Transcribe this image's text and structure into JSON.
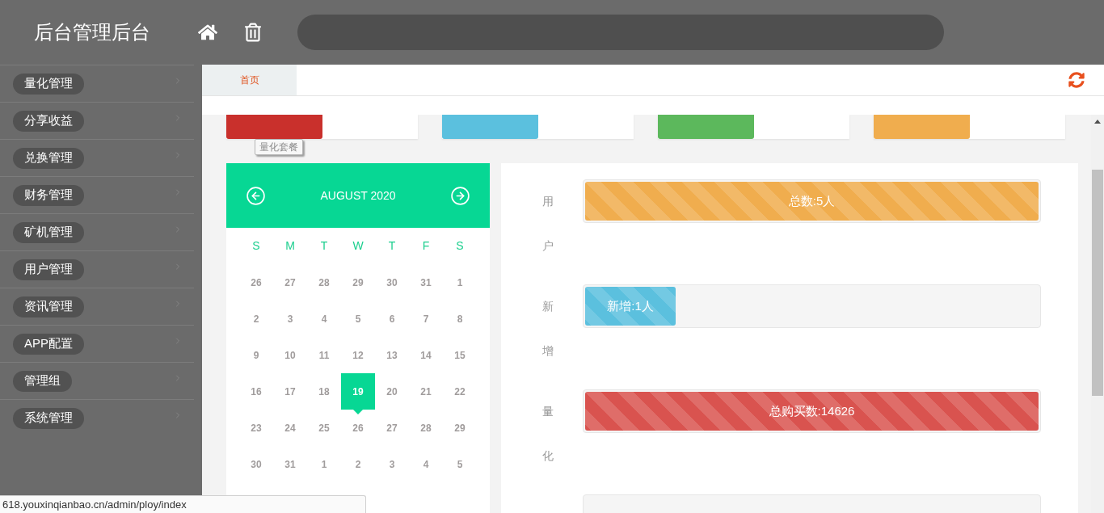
{
  "header": {
    "title": "后台管理后台"
  },
  "sidebar": {
    "items": [
      {
        "label": "量化管理"
      },
      {
        "label": "分享收益"
      },
      {
        "label": "兑换管理"
      },
      {
        "label": "财务管理"
      },
      {
        "label": "矿机管理"
      },
      {
        "label": "用户管理"
      },
      {
        "label": "资讯管理"
      },
      {
        "label": "APP配置"
      },
      {
        "label": "管理组"
      },
      {
        "label": "系统管理"
      }
    ]
  },
  "tabs": [
    {
      "label": "首页",
      "selected": true
    }
  ],
  "stat_cards": [
    {
      "color": "#c9302c"
    },
    {
      "color": "#5bc0de"
    },
    {
      "color": "#5cb85c"
    },
    {
      "color": "#f0ad4e"
    }
  ],
  "tooltip": {
    "text": "量化套餐"
  },
  "calendar": {
    "title": "AUGUST 2020",
    "weekdays": [
      "S",
      "M",
      "T",
      "W",
      "T",
      "F",
      "S"
    ],
    "weeks": [
      [
        {
          "day": "26",
          "selected": false
        },
        {
          "day": "27",
          "selected": false
        },
        {
          "day": "28",
          "selected": false
        },
        {
          "day": "29",
          "selected": false
        },
        {
          "day": "30",
          "selected": false
        },
        {
          "day": "31",
          "selected": false
        },
        {
          "day": "1",
          "selected": false
        }
      ],
      [
        {
          "day": "2",
          "selected": false
        },
        {
          "day": "3",
          "selected": false
        },
        {
          "day": "4",
          "selected": false
        },
        {
          "day": "5",
          "selected": false
        },
        {
          "day": "6",
          "selected": false
        },
        {
          "day": "7",
          "selected": false
        },
        {
          "day": "8",
          "selected": false
        }
      ],
      [
        {
          "day": "9",
          "selected": false
        },
        {
          "day": "10",
          "selected": false
        },
        {
          "day": "11",
          "selected": false
        },
        {
          "day": "12",
          "selected": false
        },
        {
          "day": "13",
          "selected": false
        },
        {
          "day": "14",
          "selected": false
        },
        {
          "day": "15",
          "selected": false
        }
      ],
      [
        {
          "day": "16",
          "selected": false
        },
        {
          "day": "17",
          "selected": false
        },
        {
          "day": "18",
          "selected": false
        },
        {
          "day": "19",
          "selected": true
        },
        {
          "day": "20",
          "selected": false
        },
        {
          "day": "21",
          "selected": false
        },
        {
          "day": "22",
          "selected": false
        }
      ],
      [
        {
          "day": "23",
          "selected": false
        },
        {
          "day": "24",
          "selected": false
        },
        {
          "day": "25",
          "selected": false
        },
        {
          "day": "26",
          "selected": false
        },
        {
          "day": "27",
          "selected": false
        },
        {
          "day": "28",
          "selected": false
        },
        {
          "day": "29",
          "selected": false
        }
      ],
      [
        {
          "day": "30",
          "selected": false
        },
        {
          "day": "31",
          "selected": false
        },
        {
          "day": "1",
          "selected": false
        },
        {
          "day": "2",
          "selected": false
        },
        {
          "day": "3",
          "selected": false
        },
        {
          "day": "4",
          "selected": false
        },
        {
          "day": "5",
          "selected": false
        }
      ]
    ]
  },
  "stats": [
    {
      "label": "用户",
      "text": "总数:5人",
      "level": 1,
      "color": "#f0ad4e"
    },
    {
      "label": "新增",
      "text": "新增:1人",
      "level": 0.2,
      "color": "#5bc0de"
    },
    {
      "label": "量化",
      "text": "总购买数:14626",
      "level": 1,
      "color": "#d9534f"
    }
  ],
  "status_bar": {
    "url": "618.youxinqianbao.cn/admin/ploy/index"
  }
}
